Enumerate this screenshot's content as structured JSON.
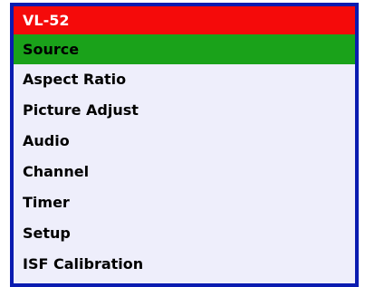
{
  "menu": {
    "title": "VL-52",
    "items": [
      {
        "label": "Source",
        "selected": true
      },
      {
        "label": "Aspect Ratio",
        "selected": false
      },
      {
        "label": "Picture Adjust",
        "selected": false
      },
      {
        "label": "Audio",
        "selected": false
      },
      {
        "label": "Channel",
        "selected": false
      },
      {
        "label": "Timer",
        "selected": false
      },
      {
        "label": "Setup",
        "selected": false
      },
      {
        "label": "ISF Calibration",
        "selected": false
      }
    ]
  },
  "colors": {
    "border": "#0a1bb0",
    "header_bg": "#f50a0a",
    "selected_bg": "#1aa21a",
    "menu_bg": "#eeeefb"
  }
}
